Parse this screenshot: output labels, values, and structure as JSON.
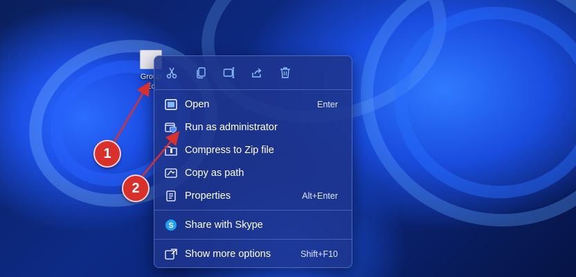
{
  "desktop": {
    "icon_label_line1": "Group",
    "icon_label_line2": "Ed"
  },
  "toolbar": {
    "cut_icon": "scissors-icon",
    "copy_icon": "copy-icon",
    "rename_icon": "rename-icon",
    "share_icon": "share-icon",
    "delete_icon": "trash-icon"
  },
  "menu": {
    "items": [
      {
        "label": "Open",
        "shortcut": "Enter",
        "icon": "open-window-icon"
      },
      {
        "label": "Run as administrator",
        "shortcut": "",
        "icon": "shield-icon"
      },
      {
        "label": "Compress to Zip file",
        "shortcut": "",
        "icon": "zip-icon"
      },
      {
        "label": "Copy as path",
        "shortcut": "",
        "icon": "copy-path-icon"
      },
      {
        "label": "Properties",
        "shortcut": "Alt+Enter",
        "icon": "properties-icon"
      },
      {
        "label": "Share with Skype",
        "shortcut": "",
        "icon": "skype-icon"
      },
      {
        "label": "Show more options",
        "shortcut": "Shift+F10",
        "icon": "more-options-icon"
      }
    ]
  },
  "callouts": [
    "1",
    "2"
  ],
  "colors": {
    "callout": "#d9302b",
    "menu_bg": "#1e348c",
    "icon_accent": "#7fb6ff"
  }
}
